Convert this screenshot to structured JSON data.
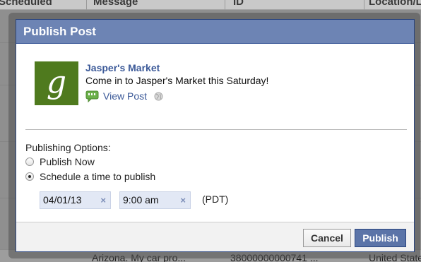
{
  "background": {
    "table_headers": [
      "Scheduled",
      "Message",
      "ID",
      "Location/L"
    ],
    "bottom_row": [
      "Arizona. My car pro...",
      "38000000000741 ...",
      "United State"
    ]
  },
  "dialog": {
    "title": "Publish Post",
    "post": {
      "page_name": "Jasper's Market",
      "message": "Come in to Jasper's Market this Saturday!",
      "view_post_label": "View Post",
      "logo_letter": "g"
    },
    "options_label": "Publishing Options:",
    "radio_options": [
      {
        "label": "Publish Now",
        "checked": false
      },
      {
        "label": "Schedule a time to publish",
        "checked": true
      }
    ],
    "schedule": {
      "date": "04/01/13",
      "time": "9:00 am",
      "remove_symbol": "×",
      "timezone": "(PDT)"
    },
    "buttons": {
      "cancel": "Cancel",
      "publish": "Publish"
    }
  },
  "colors": {
    "title_bar": "#6d84b4",
    "link": "#3b5998",
    "logo_bg": "#4f7a1e",
    "publish_button": "#5b74a8"
  }
}
